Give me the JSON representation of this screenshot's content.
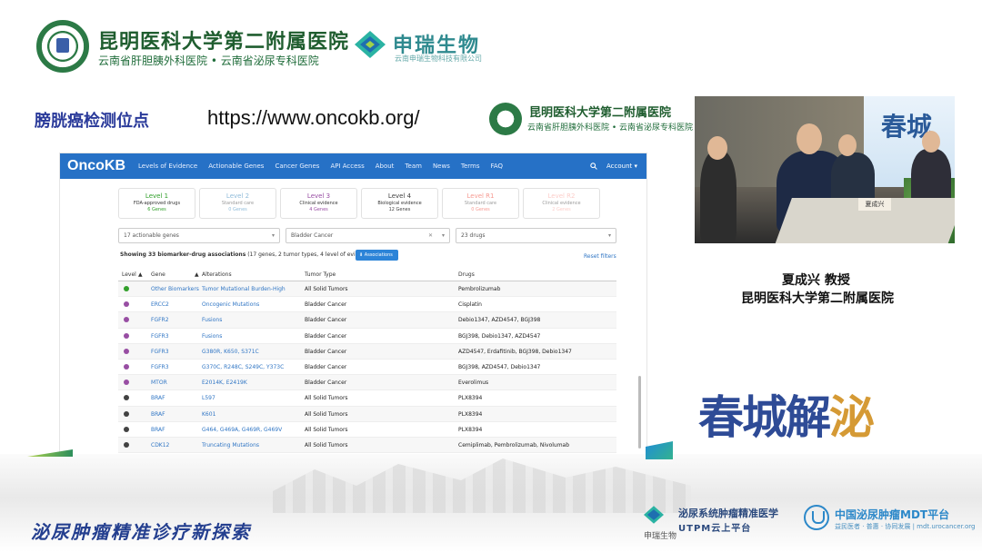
{
  "header": {
    "hospital_name": "昆明医科大学第二附属医院",
    "hospital_sub": "云南省肝胆胰外科医院 • 云南省泌尿专科医院",
    "sponsor_name": "申瑞生物",
    "sponsor_sub": "云南申瑞生物科技有限公司"
  },
  "slide": {
    "title": "膀胱癌检测位点",
    "url": "https://www.oncokb.org/",
    "corner_hospital": "昆明医科大学第二附属医院",
    "corner_sub": "云南省肝胆胰外科医院 • 云南省泌尿专科医院"
  },
  "oncokb": {
    "brand": "OncoKB",
    "nav": [
      "Levels of Evidence",
      "Actionable Genes",
      "Cancer Genes",
      "API Access",
      "About",
      "Team",
      "News",
      "Terms",
      "FAQ"
    ],
    "search_icon": "search-icon",
    "account": "Account ▾",
    "levels": [
      {
        "name": "Level 1",
        "desc": "FDA-approved drugs",
        "count": "6 Genes",
        "color": "#33a02c",
        "muted": false
      },
      {
        "name": "Level 2",
        "desc": "Standard care",
        "count": "0 Genes",
        "color": "#1f78b4",
        "muted": true
      },
      {
        "name": "Level 3",
        "desc": "Clinical evidence",
        "count": "4 Genes",
        "color": "#984ea3",
        "muted": false
      },
      {
        "name": "Level 4",
        "desc": "Biological evidence",
        "count": "12 Genes",
        "color": "#424242",
        "muted": false
      },
      {
        "name": "Level R1",
        "desc": "Standard care",
        "count": "0 Genes",
        "color": "#ee3424",
        "muted": true
      },
      {
        "name": "Level R2",
        "desc": "Clinical evidence",
        "count": "2 Genes",
        "color": "#f99a92",
        "muted": true
      }
    ],
    "filters": {
      "genes": "17 actionable genes",
      "tumor": "Bladder Cancer",
      "drugs": "23 drugs"
    },
    "showing_bold": "Showing 33 biomarker-drug associations",
    "showing_rest": "(17 genes, 2 tumor types, 4 level of evidences)",
    "associations_button": "Associations",
    "reset": "Reset filters",
    "columns": [
      "Level",
      "Gene",
      "Alterations",
      "Tumor Type",
      "Drugs"
    ],
    "rows": [
      {
        "level_color": "#33a02c",
        "gene": "Other Biomarkers",
        "alteration": "Tumor Mutational Burden-High",
        "tumor": "All Solid Tumors",
        "drugs": "Pembrolizumab"
      },
      {
        "level_color": "#984ea3",
        "gene": "ERCC2",
        "alteration": "Oncogenic Mutations",
        "tumor": "Bladder Cancer",
        "drugs": "Cisplatin"
      },
      {
        "level_color": "#984ea3",
        "gene": "FGFR2",
        "alteration": "Fusions",
        "tumor": "Bladder Cancer",
        "drugs": "Debio1347, AZD4547, BGJ398"
      },
      {
        "level_color": "#984ea3",
        "gene": "FGFR3",
        "alteration": "Fusions",
        "tumor": "Bladder Cancer",
        "drugs": "BGJ398, Debio1347, AZD4547"
      },
      {
        "level_color": "#984ea3",
        "gene": "FGFR3",
        "alteration": "G380R, K650, S371C",
        "tumor": "Bladder Cancer",
        "drugs": "AZD4547, Erdafitinib, BGJ398, Debio1347"
      },
      {
        "level_color": "#984ea3",
        "gene": "FGFR3",
        "alteration": "G370C, R248C, S249C, Y373C",
        "tumor": "Bladder Cancer",
        "drugs": "BGJ398, AZD4547, Debio1347"
      },
      {
        "level_color": "#984ea3",
        "gene": "MTOR",
        "alteration": "E2014K, E2419K",
        "tumor": "Bladder Cancer",
        "drugs": "Everolimus"
      },
      {
        "level_color": "#424242",
        "gene": "BRAF",
        "alteration": "L597",
        "tumor": "All Solid Tumors",
        "drugs": "PLX8394"
      },
      {
        "level_color": "#424242",
        "gene": "BRAF",
        "alteration": "K601",
        "tumor": "All Solid Tumors",
        "drugs": "PLX8394"
      },
      {
        "level_color": "#424242",
        "gene": "BRAF",
        "alteration": "G464, G469A, G469R, G469V",
        "tumor": "All Solid Tumors",
        "drugs": "PLX8394"
      },
      {
        "level_color": "#424242",
        "gene": "CDK12",
        "alteration": "Truncating Mutations",
        "tumor": "All Solid Tumors",
        "drugs": "Cemiplimab, Pembrolizumab, Nivolumab"
      }
    ]
  },
  "video": {
    "banner": "春城",
    "nameplate": "夏成兴"
  },
  "speaker": {
    "name": "夏成兴 教授",
    "hospital": "昆明医科大学第二附属医院"
  },
  "event": {
    "title_main": "春城解",
    "title_highlight": "泌"
  },
  "footer": {
    "slogan": "泌尿肿瘤精准诊疗新探索",
    "platform_name": "泌尿系统肿瘤精准医学",
    "platform_sub": "UTPM云上平台",
    "platform_brand": "申瑞生物",
    "mdt_name": "中国泌尿肿瘤MDT平台",
    "mdt_sub": "益民医者 · 普惠 · 协同发展 | mdt.urocancer.org"
  }
}
